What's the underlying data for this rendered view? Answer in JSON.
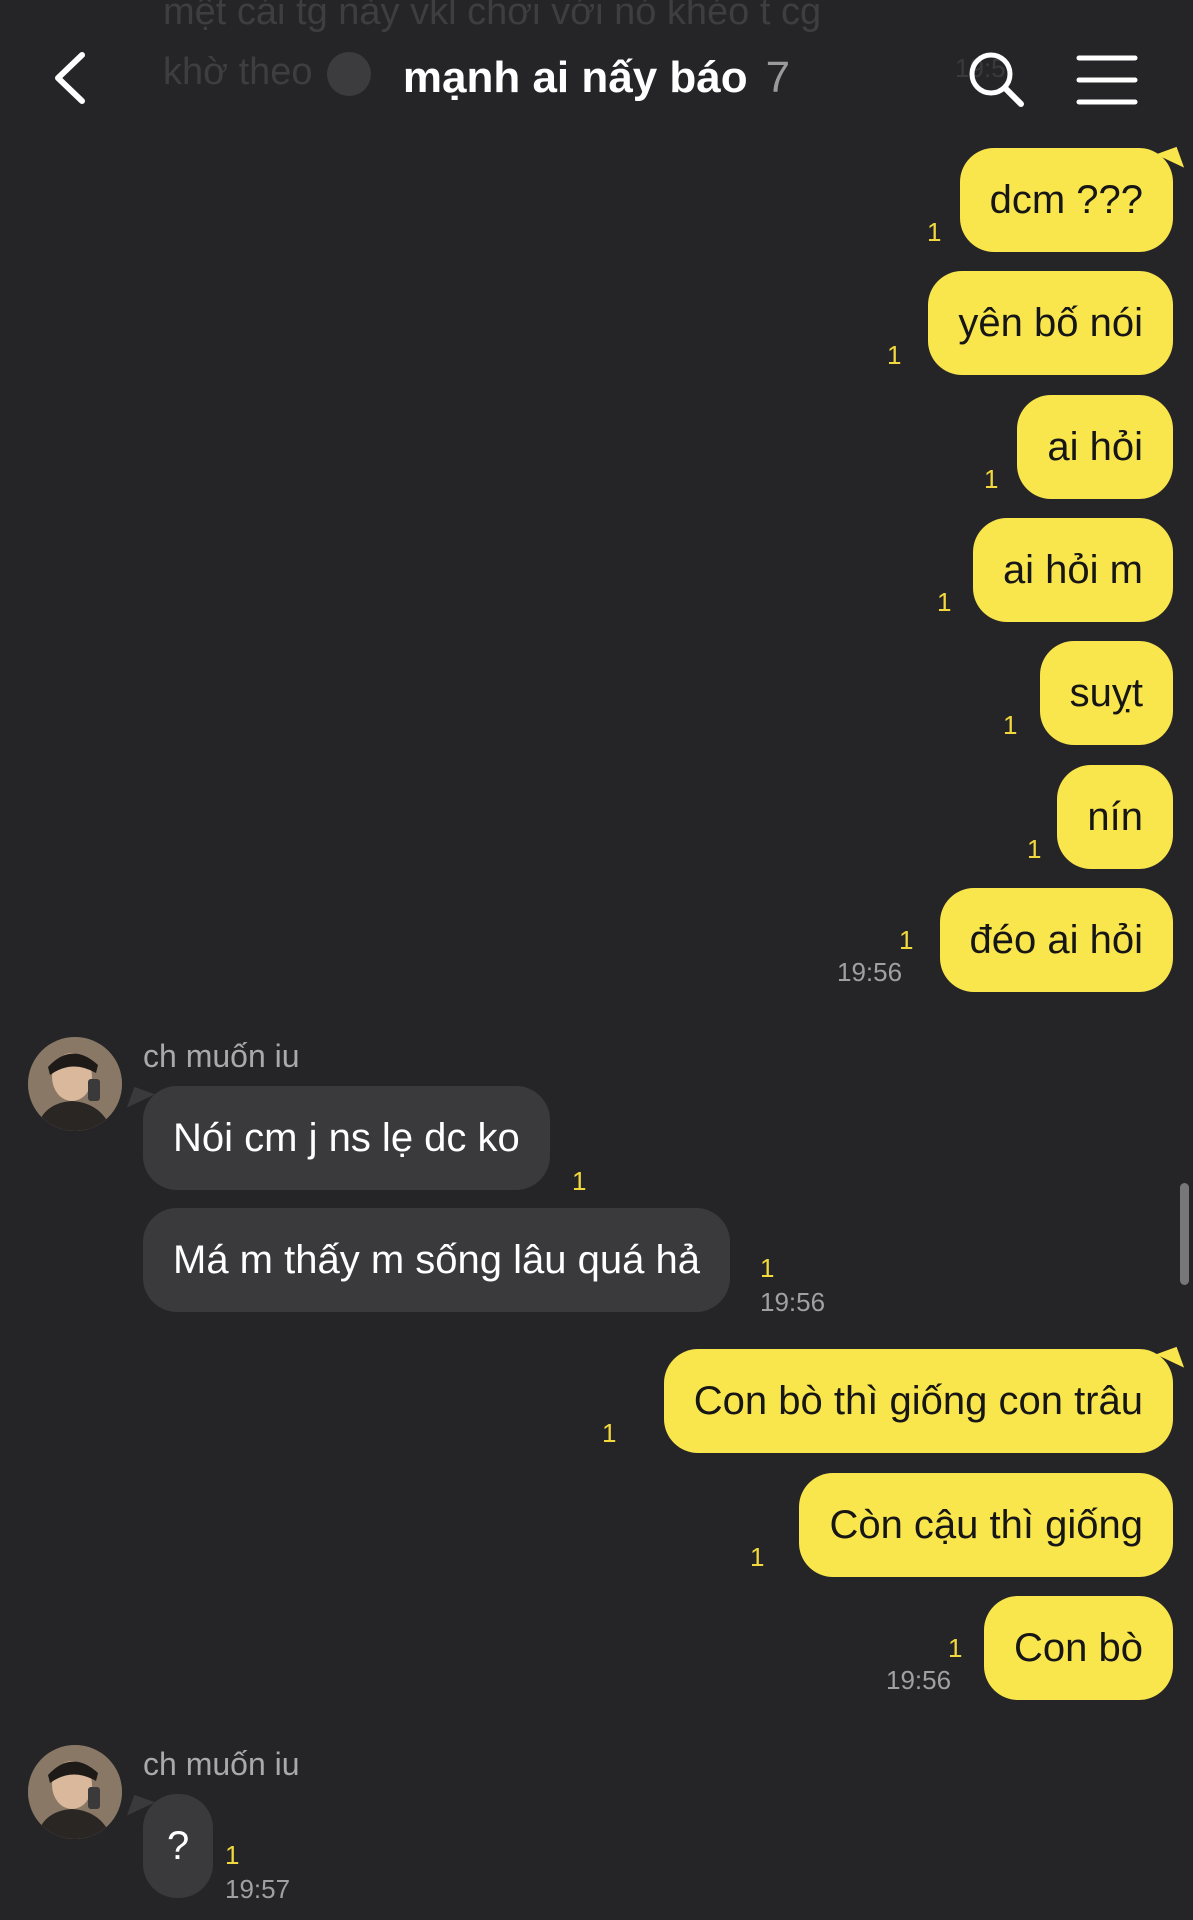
{
  "faded_message": {
    "line1": "mệt cái tg này vkl chơi với nó khéo t cg",
    "line2": "khờ theo",
    "time": "19:5"
  },
  "header": {
    "title": "mạnh ai nấy báo",
    "member_count": "7"
  },
  "messages": [
    {
      "from": "me",
      "text": "dcm ???",
      "unread": "1"
    },
    {
      "from": "me",
      "text": "yên bố nói",
      "unread": "1"
    },
    {
      "from": "me",
      "text": "ai hỏi",
      "unread": "1"
    },
    {
      "from": "me",
      "text": "ai hỏi m",
      "unread": "1"
    },
    {
      "from": "me",
      "text": "suỵt",
      "unread": "1"
    },
    {
      "from": "me",
      "text": "nín",
      "unread": "1"
    },
    {
      "from": "me",
      "text": "đéo ai hỏi",
      "unread": "1",
      "time": "19:56"
    },
    {
      "from": "them",
      "sender": "ch muốn iu",
      "text": "Nói cm j ns lẹ dc ko",
      "unread": "1"
    },
    {
      "from": "them",
      "text": "Má m thấy m sống lâu quá hả",
      "unread": "1",
      "time": "19:56"
    },
    {
      "from": "me",
      "text": "Con bò thì giống con trâu",
      "unread": "1"
    },
    {
      "from": "me",
      "text": "Còn cậu thì giống",
      "unread": "1"
    },
    {
      "from": "me",
      "text": "Con bò",
      "unread": "1",
      "time": "19:56"
    },
    {
      "from": "them",
      "sender": "ch muốn iu",
      "text": "?",
      "unread": "1",
      "time": "19:57"
    }
  ],
  "colors": {
    "my_bubble": "#f9e54c",
    "their_bubble": "#3a3a3c",
    "background": "#252527",
    "unread": "#f1d83f"
  },
  "icons": [
    "back-arrow-icon",
    "search-icon",
    "hamburger-menu-icon"
  ]
}
